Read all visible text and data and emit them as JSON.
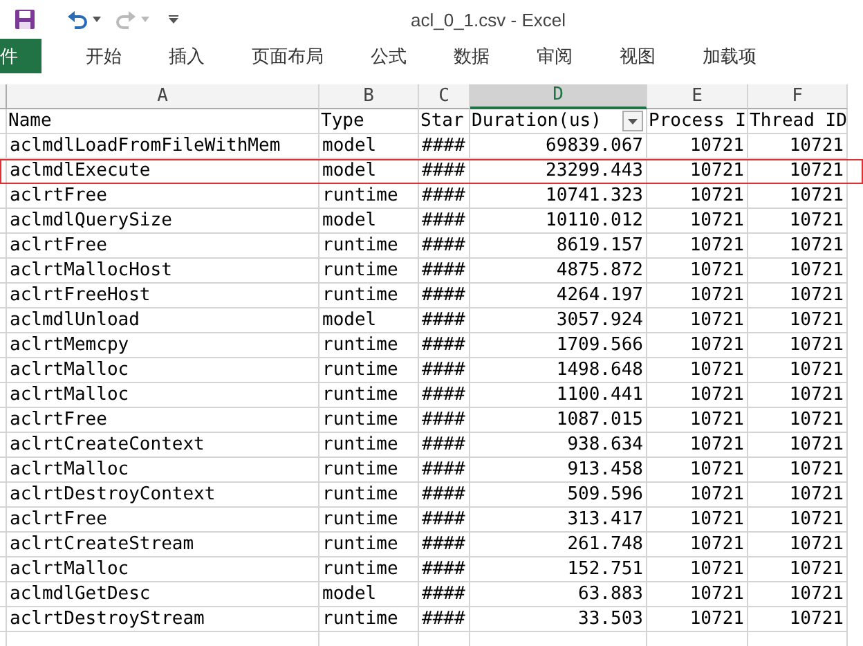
{
  "window": {
    "title": "acl_0_1.csv - Excel"
  },
  "ribbon_tabs": [
    {
      "label": "件",
      "selected": true
    },
    {
      "label": "开始",
      "selected": false
    },
    {
      "label": "插入",
      "selected": false
    },
    {
      "label": "页面布局",
      "selected": false
    },
    {
      "label": "公式",
      "selected": false
    },
    {
      "label": "数据",
      "selected": false
    },
    {
      "label": "审阅",
      "selected": false
    },
    {
      "label": "视图",
      "selected": false
    },
    {
      "label": "加载项",
      "selected": false
    }
  ],
  "columns": [
    {
      "letter": "A",
      "selected": false
    },
    {
      "letter": "B",
      "selected": false
    },
    {
      "letter": "C",
      "selected": false
    },
    {
      "letter": "D",
      "selected": true
    },
    {
      "letter": "E",
      "selected": false
    },
    {
      "letter": "F",
      "selected": false
    }
  ],
  "header_row": [
    {
      "text": "Name",
      "filter": false
    },
    {
      "text": "Type",
      "filter": false
    },
    {
      "text": "Star",
      "filter": false
    },
    {
      "text": "Duration(us)",
      "filter": true
    },
    {
      "text": "Process I",
      "filter": false
    },
    {
      "text": "Thread ID",
      "filter": false
    }
  ],
  "rows": [
    {
      "name": "aclmdlLoadFromFileWithMem",
      "type": "model",
      "start": "####",
      "duration": "69839.067",
      "process": "10721",
      "thread": "10721",
      "selected": false
    },
    {
      "name": "aclmdlExecute",
      "type": "model",
      "start": "####",
      "duration": "23299.443",
      "process": "10721",
      "thread": "10721",
      "selected": true
    },
    {
      "name": "aclrtFree",
      "type": "runtime",
      "start": "####",
      "duration": "10741.323",
      "process": "10721",
      "thread": "10721",
      "selected": false
    },
    {
      "name": "aclmdlQuerySize",
      "type": "model",
      "start": "####",
      "duration": "10110.012",
      "process": "10721",
      "thread": "10721",
      "selected": false
    },
    {
      "name": "aclrtFree",
      "type": "runtime",
      "start": "####",
      "duration": "8619.157",
      "process": "10721",
      "thread": "10721",
      "selected": false
    },
    {
      "name": "aclrtMallocHost",
      "type": "runtime",
      "start": "####",
      "duration": "4875.872",
      "process": "10721",
      "thread": "10721",
      "selected": false
    },
    {
      "name": "aclrtFreeHost",
      "type": "runtime",
      "start": "####",
      "duration": "4264.197",
      "process": "10721",
      "thread": "10721",
      "selected": false
    },
    {
      "name": "aclmdlUnload",
      "type": "model",
      "start": "####",
      "duration": "3057.924",
      "process": "10721",
      "thread": "10721",
      "selected": false
    },
    {
      "name": "aclrtMemcpy",
      "type": "runtime",
      "start": "####",
      "duration": "1709.566",
      "process": "10721",
      "thread": "10721",
      "selected": false
    },
    {
      "name": "aclrtMalloc",
      "type": "runtime",
      "start": "####",
      "duration": "1498.648",
      "process": "10721",
      "thread": "10721",
      "selected": false
    },
    {
      "name": "aclrtMalloc",
      "type": "runtime",
      "start": "####",
      "duration": "1100.441",
      "process": "10721",
      "thread": "10721",
      "selected": false
    },
    {
      "name": "aclrtFree",
      "type": "runtime",
      "start": "####",
      "duration": "1087.015",
      "process": "10721",
      "thread": "10721",
      "selected": false
    },
    {
      "name": "aclrtCreateContext",
      "type": "runtime",
      "start": "####",
      "duration": "938.634",
      "process": "10721",
      "thread": "10721",
      "selected": false
    },
    {
      "name": "aclrtMalloc",
      "type": "runtime",
      "start": "####",
      "duration": "913.458",
      "process": "10721",
      "thread": "10721",
      "selected": false
    },
    {
      "name": "aclrtDestroyContext",
      "type": "runtime",
      "start": "####",
      "duration": "509.596",
      "process": "10721",
      "thread": "10721",
      "selected": false
    },
    {
      "name": "aclrtFree",
      "type": "runtime",
      "start": "####",
      "duration": "313.417",
      "process": "10721",
      "thread": "10721",
      "selected": false
    },
    {
      "name": "aclrtCreateStream",
      "type": "runtime",
      "start": "####",
      "duration": "261.748",
      "process": "10721",
      "thread": "10721",
      "selected": false
    },
    {
      "name": "aclrtMalloc",
      "type": "runtime",
      "start": "####",
      "duration": "152.751",
      "process": "10721",
      "thread": "10721",
      "selected": false
    },
    {
      "name": "aclmdlGetDesc",
      "type": "model",
      "start": "####",
      "duration": "63.883",
      "process": "10721",
      "thread": "10721",
      "selected": false
    },
    {
      "name": "aclrtDestroyStream",
      "type": "runtime",
      "start": "####",
      "duration": "33.503",
      "process": "10721",
      "thread": "10721",
      "selected": false
    }
  ]
}
